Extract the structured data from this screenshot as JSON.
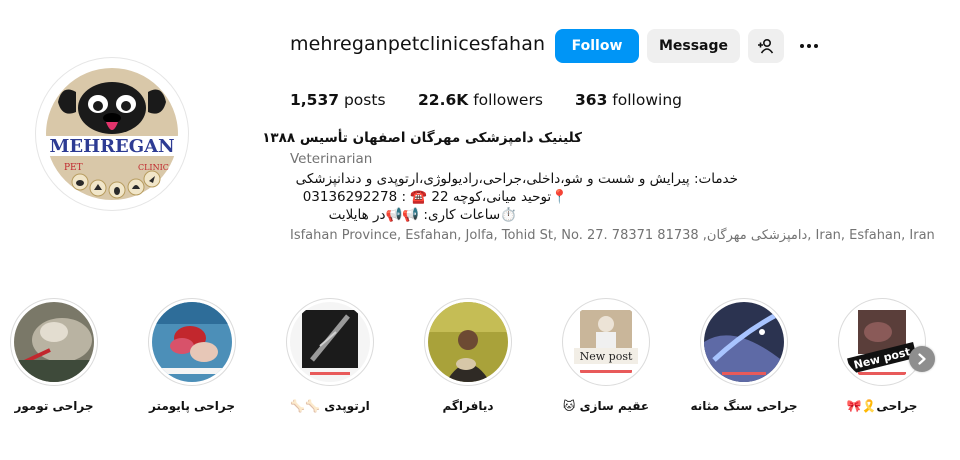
{
  "profile": {
    "username": "mehreganpetclinicesfahan",
    "avatar_logo_text": "MEHREGAN",
    "avatar_pet_text": "PET",
    "avatar_clinic_text": "CLINIC"
  },
  "actions": {
    "follow_label": "Follow",
    "message_label": "Message",
    "suggest_icon": "add-person-icon",
    "more_icon": "more-options-icon"
  },
  "stats": {
    "posts_count": "1,537",
    "posts_label": "posts",
    "followers_count": "22.6K",
    "followers_label": "followers",
    "following_count": "363",
    "following_label": "following"
  },
  "bio": {
    "name": "کلینیک دامپزشکی مهرگان اصفهان تأسیس ۱۳۸۸",
    "category": "Veterinarian",
    "line1": "خدمات: پیرایش و شست و شو،داخلی،جراحی،رادیولوژی،ارتوپدی و دندانپزشکی",
    "line2": "📍توحید میانی،کوچه 22 ☎️ : 03136292278",
    "line3": "⏱️ساعات کاری: 📢📢در هایلایت",
    "address": "Isfahan Province, Esfahan, Jolfa, Tohid St, No. 27. 78371 81738 ,دامپزشکی مهرگان, Iran, Esfahan, Iran"
  },
  "highlights": [
    {
      "label": "جراحی تومور",
      "badge": ""
    },
    {
      "label": "جراحی پایومتر",
      "badge": ""
    },
    {
      "label": "ارتوپدی 🦴🦴",
      "badge": ""
    },
    {
      "label": "دیافراگم",
      "badge": ""
    },
    {
      "label": "عقیم سازی 🐱",
      "badge": "New post"
    },
    {
      "label": "جراحی سنگ مثانه",
      "badge": ""
    },
    {
      "label": "جراحی🎗️🎀",
      "badge": "New post"
    }
  ],
  "colors": {
    "accent": "#0095f6",
    "secondary_button": "#efefef",
    "muted_text": "#737373",
    "logo_red": "#c0272d",
    "logo_blue": "#2d3b93"
  }
}
